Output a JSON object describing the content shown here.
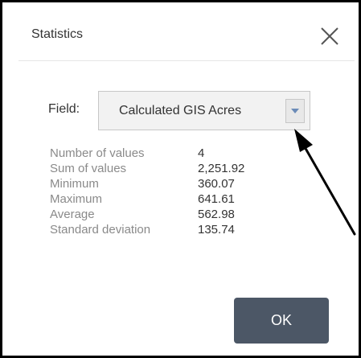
{
  "dialog": {
    "title": "Statistics",
    "close_icon": "close-icon"
  },
  "field": {
    "label": "Field:",
    "selected": "Calculated GIS Acres",
    "dropdown_icon": "chevron-down-icon"
  },
  "stats": [
    {
      "label": "Number of values",
      "value": "4"
    },
    {
      "label": "Sum of values",
      "value": "2,251.92"
    },
    {
      "label": "Minimum",
      "value": "360.07"
    },
    {
      "label": "Maximum",
      "value": "641.61"
    },
    {
      "label": "Average",
      "value": "562.98"
    },
    {
      "label": "Standard deviation",
      "value": "135.74"
    }
  ],
  "ok_button": {
    "label": "OK"
  },
  "annotation": {
    "icon": "arrow-icon"
  },
  "colors": {
    "button_bg": "#4c5766",
    "label_text": "#8a8a8a",
    "value_text": "#333333",
    "dropdown_arrow": "#6b8bb8",
    "border": "#000000"
  }
}
